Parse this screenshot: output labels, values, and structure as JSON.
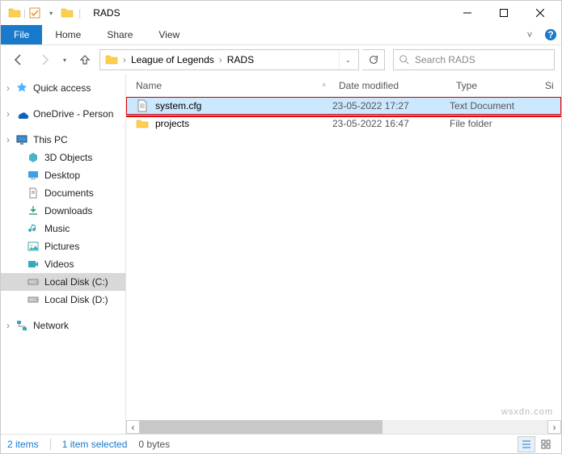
{
  "title": "RADS",
  "qat": {
    "checkbox_checked": true
  },
  "ribbon": {
    "file": "File",
    "tabs": [
      "Home",
      "Share",
      "View"
    ]
  },
  "breadcrumb": [
    "League of Legends",
    "RADS"
  ],
  "search": {
    "placeholder": "Search RADS"
  },
  "tree": {
    "sections": [
      {
        "items": [
          {
            "label": "Quick access",
            "icon": "star",
            "expandable": true
          }
        ]
      },
      {
        "items": [
          {
            "label": "OneDrive - Person",
            "icon": "onedrive",
            "expandable": true
          }
        ]
      },
      {
        "items": [
          {
            "label": "This PC",
            "icon": "pc",
            "expandable": true
          },
          {
            "label": "3D Objects",
            "icon": "3d",
            "sub": true
          },
          {
            "label": "Desktop",
            "icon": "desktop",
            "sub": true
          },
          {
            "label": "Documents",
            "icon": "documents",
            "sub": true
          },
          {
            "label": "Downloads",
            "icon": "downloads",
            "sub": true
          },
          {
            "label": "Music",
            "icon": "music",
            "sub": true
          },
          {
            "label": "Pictures",
            "icon": "pictures",
            "sub": true
          },
          {
            "label": "Videos",
            "icon": "videos",
            "sub": true
          },
          {
            "label": "Local Disk (C:)",
            "icon": "disk",
            "sub": true,
            "selected": true
          },
          {
            "label": "Local Disk (D:)",
            "icon": "disk",
            "sub": true
          }
        ]
      },
      {
        "items": [
          {
            "label": "Network",
            "icon": "network",
            "expandable": true
          }
        ]
      }
    ]
  },
  "columns": {
    "name": "Name",
    "date": "Date modified",
    "type": "Type",
    "size": "Si"
  },
  "files": [
    {
      "name": "projects",
      "date": "23-05-2022 16:47",
      "type": "File folder",
      "icon": "folder",
      "selected": false,
      "highlight": false
    },
    {
      "name": "system.cfg",
      "date": "23-05-2022 17:27",
      "type": "Text Document",
      "icon": "file",
      "selected": true,
      "highlight": true
    }
  ],
  "status": {
    "count": "2 items",
    "selected": "1 item selected",
    "size": "0 bytes"
  },
  "watermark": "wsxdn.com"
}
